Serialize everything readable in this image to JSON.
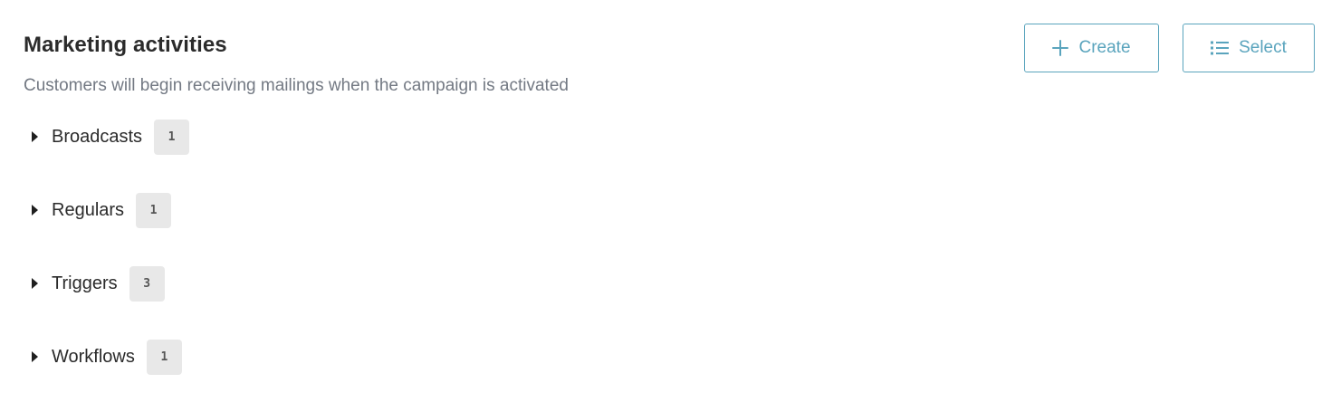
{
  "header": {
    "title": "Marketing activities",
    "subtitle": "Customers will begin receiving mailings when the campaign is activated"
  },
  "actions": {
    "create_label": "Create",
    "create_icon": "plus-icon",
    "select_label": "Select",
    "select_icon": "list-icon"
  },
  "groups": [
    {
      "label": "Broadcasts",
      "count": "1",
      "expanded": false
    },
    {
      "label": "Regulars",
      "count": "1",
      "expanded": false
    },
    {
      "label": "Triggers",
      "count": "3",
      "expanded": false
    },
    {
      "label": "Workflows",
      "count": "1",
      "expanded": false
    }
  ],
  "colors": {
    "accent": "#5aa4bd",
    "subtitle_text": "#737983",
    "badge_bg": "#e8e8e8"
  }
}
